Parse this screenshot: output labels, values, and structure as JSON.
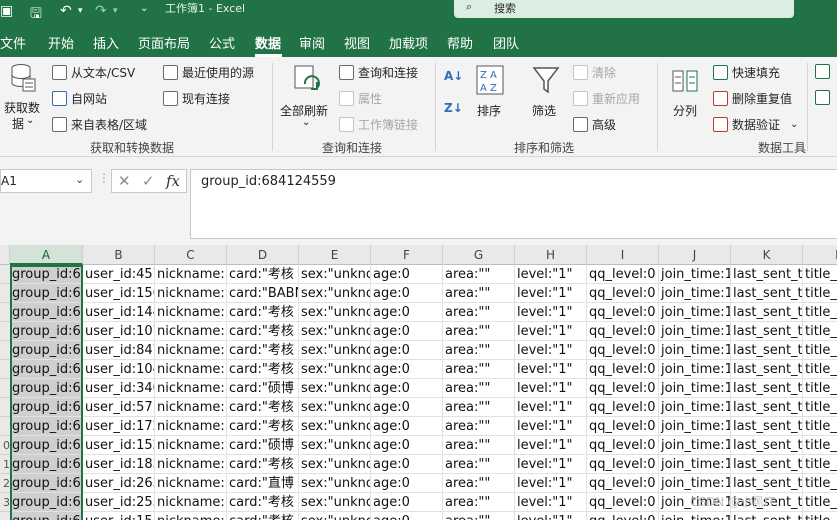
{
  "titlebar": {
    "title": "工作簿1  -  Excel",
    "search_placeholder": "搜索"
  },
  "menu": {
    "tabs": [
      "文件",
      "开始",
      "插入",
      "页面布局",
      "公式",
      "数据",
      "审阅",
      "视图",
      "加载项",
      "帮助",
      "团队"
    ],
    "active": "数据"
  },
  "ribbon": {
    "get_data": {
      "big_label_1": "获取数",
      "big_label_2": "据",
      "from_text_csv": "从文本/CSV",
      "from_web": "自网站",
      "from_table": "来自表格/区域",
      "recent_sources": "最近使用的源",
      "existing_connections": "现有连接",
      "group_label": "获取和转换数据"
    },
    "queries": {
      "refresh_all": "全部刷新",
      "queries_connections": "查询和连接",
      "properties": "属性",
      "edit_links": "工作簿链接",
      "group_label": "查询和连接"
    },
    "sort_filter": {
      "sort": "排序",
      "filter": "筛选",
      "clear": "清除",
      "reapply": "重新应用",
      "advanced": "高级",
      "group_label": "排序和筛选"
    },
    "data_tools": {
      "text_to_columns": "分列",
      "flash_fill": "快速填充",
      "remove_duplicates": "删除重复值",
      "data_validation": "数据验证",
      "group_label": "数据工具"
    }
  },
  "formula_bar": {
    "name_box": "A1",
    "formula": "group_id:684124559"
  },
  "grid": {
    "columns": [
      "A",
      "B",
      "C",
      "D",
      "E",
      "F",
      "G",
      "H",
      "I",
      "J",
      "K",
      "L"
    ],
    "row_numbers": [
      "",
      "",
      "",
      "",
      "",
      "",
      "",
      "",
      "",
      "0",
      "1",
      "2",
      "3",
      ""
    ],
    "rows": [
      [
        "group_id:6",
        "user_id:457",
        "nickname:\"",
        "card:\"考核",
        "sex:\"unkno",
        "age:0",
        "area:\"\"",
        "level:\"1\"",
        "qq_level:0",
        "join_time:1",
        "last_sent_ti",
        "title_e"
      ],
      [
        "group_id:6",
        "user_id:156",
        "nickname:\"",
        "card:\"BABN",
        "sex:\"unkno",
        "age:0",
        "area:\"\"",
        "level:\"1\"",
        "qq_level:0",
        "join_time:1",
        "last_sent_ti",
        "title_e"
      ],
      [
        "group_id:6",
        "user_id:144",
        "nickname:\"",
        "card:\"考核",
        "sex:\"unkno",
        "age:0",
        "area:\"\"",
        "level:\"1\"",
        "qq_level:0",
        "join_time:1",
        "last_sent_ti",
        "title_e"
      ],
      [
        "group_id:6",
        "user_id:107",
        "nickname:\"",
        "card:\"考核",
        "sex:\"unkno",
        "age:0",
        "area:\"\"",
        "level:\"1\"",
        "qq_level:0",
        "join_time:1",
        "last_sent_ti",
        "title_e"
      ],
      [
        "group_id:6",
        "user_id:847",
        "nickname:\"",
        "card:\"考核",
        "sex:\"unkno",
        "age:0",
        "area:\"\"",
        "level:\"1\"",
        "qq_level:0",
        "join_time:1",
        "last_sent_ti",
        "title_e"
      ],
      [
        "group_id:6",
        "user_id:104",
        "nickname:\"",
        "card:\"考核",
        "sex:\"unkno",
        "age:0",
        "area:\"\"",
        "level:\"1\"",
        "qq_level:0",
        "join_time:1",
        "last_sent_ti",
        "title_e"
      ],
      [
        "group_id:6",
        "user_id:340",
        "nickname:\"",
        "card:\"硕博",
        "sex:\"unkno",
        "age:0",
        "area:\"\"",
        "level:\"1\"",
        "qq_level:0",
        "join_time:1",
        "last_sent_ti",
        "title_e"
      ],
      [
        "group_id:6",
        "user_id:571",
        "nickname:\"",
        "card:\"考核",
        "sex:\"unkno",
        "age:0",
        "area:\"\"",
        "level:\"1\"",
        "qq_level:0",
        "join_time:1",
        "last_sent_ti",
        "title_e"
      ],
      [
        "group_id:6",
        "user_id:172",
        "nickname:\"",
        "card:\"考核",
        "sex:\"unkno",
        "age:0",
        "area:\"\"",
        "level:\"1\"",
        "qq_level:0",
        "join_time:1",
        "last_sent_ti",
        "title_e"
      ],
      [
        "group_id:6",
        "user_id:152",
        "nickname:\"",
        "card:\"硕博",
        "sex:\"unkno",
        "age:0",
        "area:\"\"",
        "level:\"1\"",
        "qq_level:0",
        "join_time:1",
        "last_sent_ti",
        "title_e"
      ],
      [
        "group_id:6",
        "user_id:183",
        "nickname:\"",
        "card:\"考核",
        "sex:\"unkno",
        "age:0",
        "area:\"\"",
        "level:\"1\"",
        "qq_level:0",
        "join_time:1",
        "last_sent_ti",
        "title_e"
      ],
      [
        "group_id:6",
        "user_id:263",
        "nickname:\"",
        "card:\"直博",
        "sex:\"unkno",
        "age:0",
        "area:\"\"",
        "level:\"1\"",
        "qq_level:0",
        "join_time:1",
        "last_sent_ti",
        "title_e"
      ],
      [
        "group_id:6",
        "user_id:255",
        "nickname:\"",
        "card:\"考核",
        "sex:\"unkno",
        "age:0",
        "area:\"\"",
        "level:\"1\"",
        "qq_level:0",
        "join_time:1",
        "last_sent_ti",
        "title_e"
      ],
      [
        "group_id:6",
        "user_id:151",
        "nickname:\"",
        "card:\"考核",
        "sex:\"unkno",
        "age:0",
        "area:\"\"",
        "level:\"1\"",
        "qq_level:0",
        "join_time:1",
        "last_sent_ti",
        "title_e"
      ]
    ]
  },
  "colors": {
    "excel_green": "#217346",
    "ribbon_bg": "#f3f3f3",
    "selected_cell_bg": "#cfcfcf"
  }
}
